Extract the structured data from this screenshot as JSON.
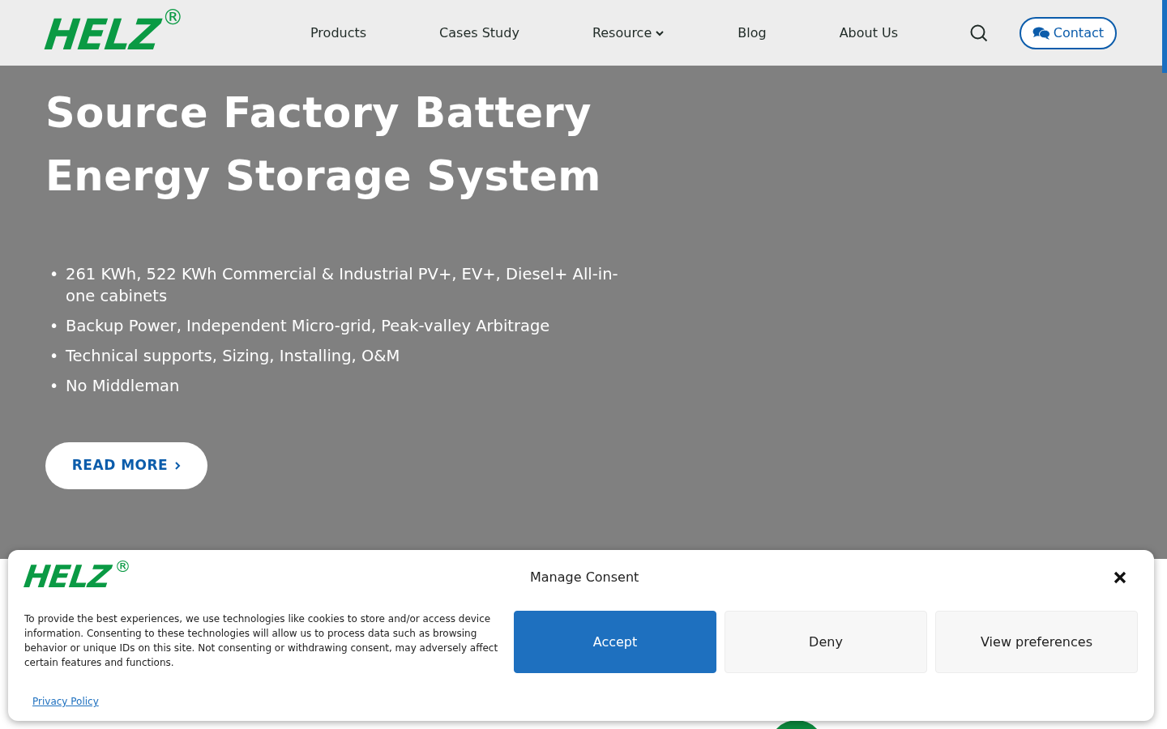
{
  "header": {
    "logo": {
      "text": "HELZ",
      "mark": "®"
    },
    "nav": [
      {
        "label": "Products",
        "has_menu": false
      },
      {
        "label": "Cases Study",
        "has_menu": false
      },
      {
        "label": "Resource",
        "has_menu": true
      },
      {
        "label": "Blog",
        "has_menu": false
      },
      {
        "label": "About Us",
        "has_menu": false
      }
    ],
    "contact_button": "Contact"
  },
  "hero": {
    "title": "Source Factory Battery Energy Storage System",
    "bullets": [
      "261 KWh, 522 KWh Commercial & Industrial PV+, EV+, Diesel+ All-in-one cabinets",
      "Backup Power, Independent Micro-grid, Peak-valley Arbitrage",
      "Technical supports, Sizing, Installing, O&M",
      "No Middleman"
    ],
    "marker": "•",
    "button": "READ MORE"
  },
  "consent": {
    "logo": {
      "text": "HELZ",
      "mark": "®"
    },
    "title": "Manage Consent",
    "body": "To provide the best experiences, we use technologies like cookies to store and/or access device information. Consenting to these technologies will allow us to process data such as browsing behavior or unique IDs on this site. Not consenting or withdrawing consent, may adversely affect certain features and functions.",
    "buttons": [
      {
        "label": "Accept",
        "kind": "primary"
      },
      {
        "label": "Deny",
        "kind": "secondary"
      },
      {
        "label": "View preferences",
        "kind": "secondary"
      }
    ],
    "link": "Privacy Policy"
  }
}
